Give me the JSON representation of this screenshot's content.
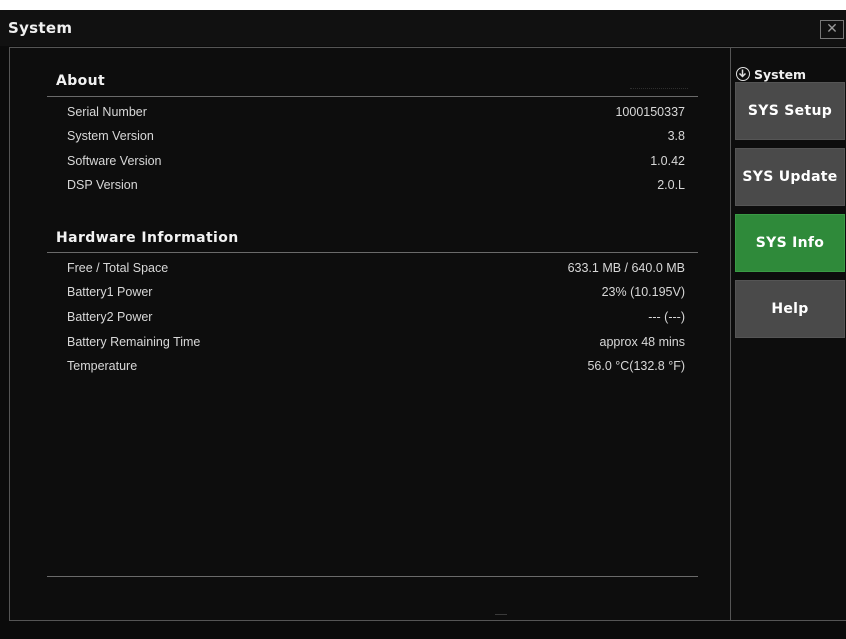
{
  "window": {
    "title": "System",
    "close_glyph": "✕"
  },
  "about": {
    "heading": "About",
    "rows": [
      {
        "label": "Serial Number",
        "value": "1000150337"
      },
      {
        "label": "System Version",
        "value": "3.8"
      },
      {
        "label": "Software Version",
        "value": "1.0.42"
      },
      {
        "label": "DSP Version",
        "value": "2.0.L"
      }
    ]
  },
  "hardware": {
    "heading": "Hardware Information",
    "rows": [
      {
        "label": "Free / Total Space",
        "value": "633.1 MB / 640.0 MB"
      },
      {
        "label": "Battery1 Power",
        "value": "23% (10.195V)"
      },
      {
        "label": "Battery2 Power",
        "value": "--- (---)"
      },
      {
        "label": "Battery Remaining Time",
        "value": "approx 48 mins"
      },
      {
        "label": "Temperature",
        "value": "56.0 °C(132.8 °F)"
      }
    ]
  },
  "nav": {
    "heading": "System",
    "heading_icon": "down-arrow-circle-icon",
    "buttons": [
      {
        "label": "SYS Setup",
        "active": false
      },
      {
        "label": "SYS Update",
        "active": false
      },
      {
        "label": "SYS Info",
        "active": true
      },
      {
        "label": "Help",
        "active": false
      }
    ]
  },
  "colors": {
    "background": "#0b0b0b",
    "button": "#4a4a4a",
    "active_button": "#2f8a3a",
    "text": "#e8e8e8"
  }
}
